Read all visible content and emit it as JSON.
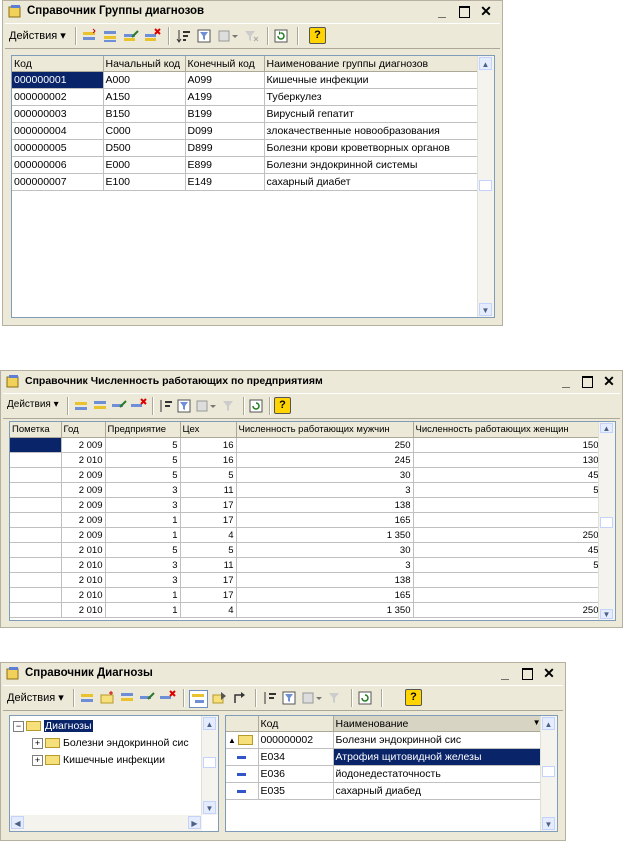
{
  "win1": {
    "title": "Справочник Группы диагнозов",
    "actions_label": "Действия",
    "columns": [
      "Код",
      "Начальный код",
      "Конечный код",
      "Наименование группы диагнозов"
    ],
    "rows": [
      [
        "000000001",
        "A000",
        "A099",
        "Кишечные инфекции"
      ],
      [
        "000000002",
        "A150",
        "A199",
        "Туберкулез"
      ],
      [
        "000000003",
        "B150",
        "B199",
        "Вирусный гепатит"
      ],
      [
        "000000004",
        "C000",
        "D099",
        "злокачественные новообразования"
      ],
      [
        "000000005",
        "D500",
        "D899",
        "Болезни крови кроветворных органов"
      ],
      [
        "000000006",
        "E000",
        "E899",
        "Болезни эндокринной системы"
      ],
      [
        "000000007",
        "E100",
        "E149",
        "сахарный диабет"
      ]
    ]
  },
  "win2": {
    "title": "Справочник Численность работающих по предприятиям",
    "actions_label": "Действия",
    "columns": [
      "Пометка",
      "Год",
      "Предприятие",
      "Цех",
      "Численность работающих мужчин",
      "Численность работающих женщин"
    ],
    "rows": [
      [
        "",
        "2 009",
        "5",
        "16",
        "250",
        "150"
      ],
      [
        "",
        "2 010",
        "5",
        "16",
        "245",
        "130"
      ],
      [
        "",
        "2 009",
        "5",
        "5",
        "30",
        "45"
      ],
      [
        "",
        "2 009",
        "3",
        "11",
        "3",
        "5"
      ],
      [
        "",
        "2 009",
        "3",
        "17",
        "138",
        ""
      ],
      [
        "",
        "2 009",
        "1",
        "17",
        "165",
        ""
      ],
      [
        "",
        "2 009",
        "1",
        "4",
        "1 350",
        "250"
      ],
      [
        "",
        "2 010",
        "5",
        "5",
        "30",
        "45"
      ],
      [
        "",
        "2 010",
        "3",
        "11",
        "3",
        "5"
      ],
      [
        "",
        "2 010",
        "3",
        "17",
        "138",
        ""
      ],
      [
        "",
        "2 010",
        "1",
        "17",
        "165",
        ""
      ],
      [
        "",
        "2 010",
        "1",
        "4",
        "1 350",
        "250"
      ]
    ]
  },
  "win3": {
    "title": "Справочник Диагнозы",
    "actions_label": "Действия",
    "tree": {
      "root": "Диагнозы",
      "children": [
        "Болезни эндокринной сис",
        "Кишечные инфекции"
      ]
    },
    "columns": [
      "Код",
      "Наименование"
    ],
    "rows": [
      [
        "000000002",
        "Болезни эндокринной сис"
      ],
      [
        "E034",
        "Атрофия щитовидной железы"
      ],
      [
        "E036",
        "йодонедестаточность"
      ],
      [
        "E035",
        "сахарный диабед"
      ]
    ]
  },
  "icons": {
    "title": "catalog-book-icon",
    "help": "?"
  }
}
